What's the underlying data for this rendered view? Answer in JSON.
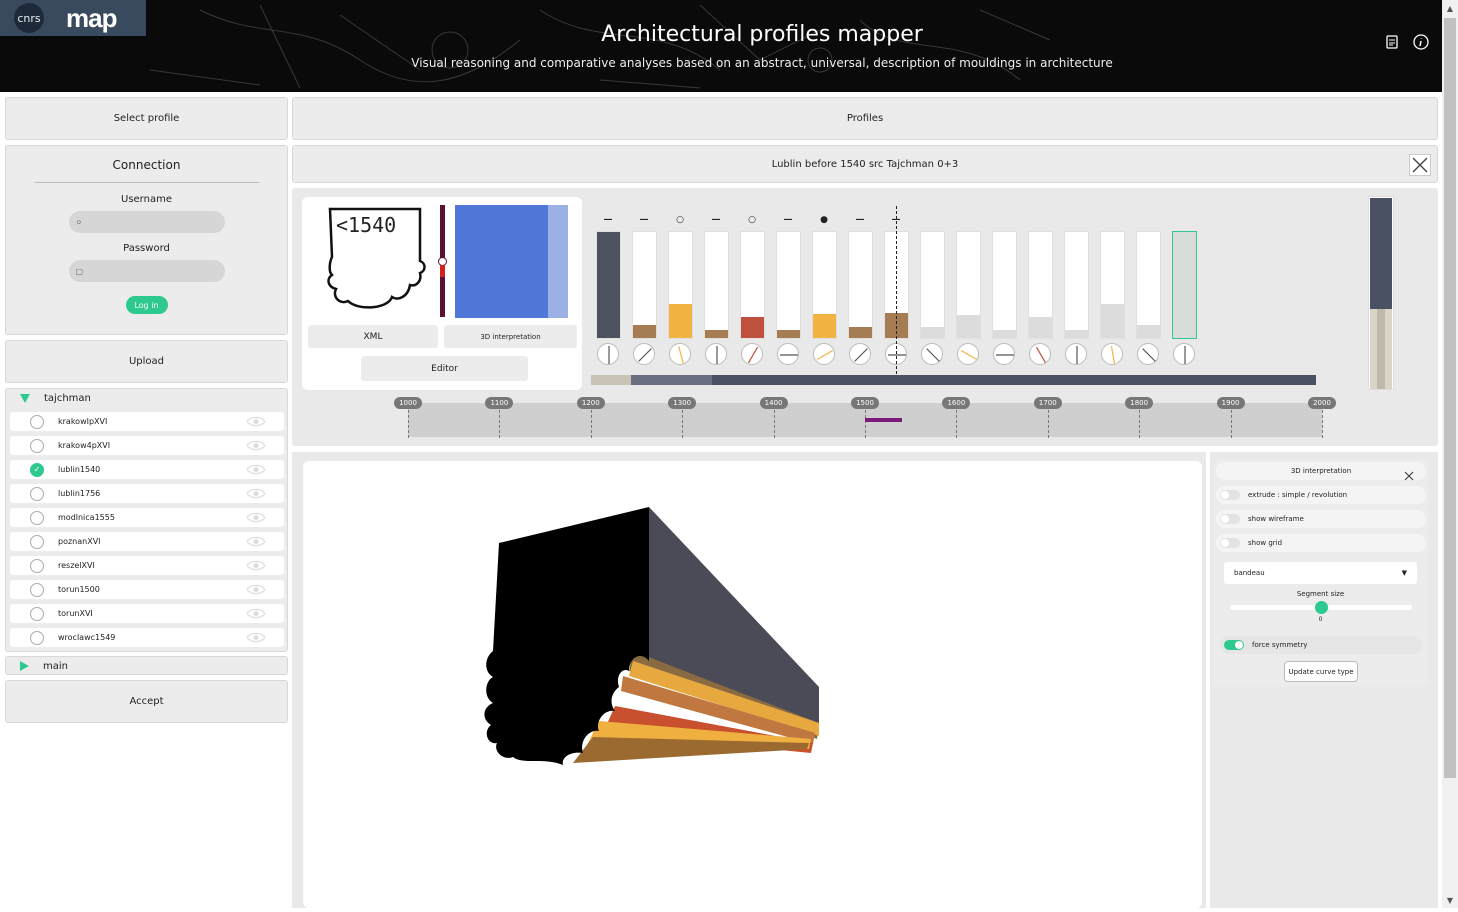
{
  "header": {
    "logo_org": "cnrs",
    "logo_app": "map",
    "title": "Architectural profiles mapper",
    "subtitle": "Visual reasoning and comparative analyses based on an abstract, universal, description of mouldings in architecture",
    "icons": [
      "document-icon",
      "info-icon"
    ]
  },
  "left": {
    "select_profile": "Select profile",
    "connection": {
      "title": "Connection",
      "username_label": "Username",
      "password_label": "Password",
      "login_label": "Log in"
    },
    "upload": "Upload",
    "groups": [
      {
        "name": "tajchman",
        "expanded": true,
        "items": [
          {
            "label": "krakowIpXVI",
            "checked": false
          },
          {
            "label": "krakow4pXVI",
            "checked": false
          },
          {
            "label": "lublin1540",
            "checked": true
          },
          {
            "label": "lublin1756",
            "checked": false
          },
          {
            "label": "modlnica1555",
            "checked": false
          },
          {
            "label": "poznanXVI",
            "checked": false
          },
          {
            "label": "reszelXVI",
            "checked": false
          },
          {
            "label": "torun1500",
            "checked": false
          },
          {
            "label": "torunXVI",
            "checked": false
          },
          {
            "label": "wroclawc1549",
            "checked": false
          }
        ]
      },
      {
        "name": "main",
        "expanded": false
      }
    ],
    "accept": "Accept"
  },
  "profiles": {
    "header": "Profiles",
    "current": "Lublin before 1540 src Tajchman 0+3",
    "profile_image_text": "<1540",
    "xml_label": "XML",
    "interp_label": "3D interpretation",
    "editor_label": "Editor",
    "bars": [
      {
        "level": 1.0,
        "color": "#4d5260",
        "symbol": "dash"
      },
      {
        "level": 0.12,
        "color": "#a67c52",
        "symbol": "dash"
      },
      {
        "level": 0.32,
        "color": "#f2b342",
        "symbol": "circle"
      },
      {
        "level": 0.08,
        "color": "#a67c52",
        "symbol": "dash"
      },
      {
        "level": 0.2,
        "color": "#c0503e",
        "symbol": "circle"
      },
      {
        "level": 0.08,
        "color": "#a67c52",
        "symbol": "dash"
      },
      {
        "level": 0.23,
        "color": "#f2b342",
        "symbol": "dot"
      },
      {
        "level": 0.1,
        "color": "#a67c52",
        "symbol": "dash"
      },
      {
        "level": 0.24,
        "color": "#a67c52",
        "symbol": "dash"
      },
      {
        "level": 0.1,
        "color": "#dcdcdc",
        "symbol": ""
      },
      {
        "level": 0.22,
        "color": "#dcdcdc",
        "symbol": ""
      },
      {
        "level": 0.08,
        "color": "#dcdcdc",
        "symbol": ""
      },
      {
        "level": 0.2,
        "color": "#dcdcdc",
        "symbol": ""
      },
      {
        "level": 0.08,
        "color": "#dcdcdc",
        "symbol": ""
      },
      {
        "level": 0.32,
        "color": "#dcdcdc",
        "symbol": ""
      },
      {
        "level": 0.12,
        "color": "#dcdcdc",
        "symbol": ""
      },
      {
        "level": 1.0,
        "color": "#d9dcd9",
        "symbol": ""
      }
    ],
    "dial_angles": [
      0,
      135,
      15,
      0,
      150,
      90,
      120,
      135,
      90,
      45,
      60,
      90,
      30,
      0,
      10,
      45,
      0
    ],
    "timeline_ticks": [
      "1000",
      "1100",
      "1200",
      "1300",
      "1400",
      "1500",
      "1600",
      "1700",
      "1800",
      "1900",
      "2000"
    ],
    "timeline_range": [
      1000,
      2000
    ],
    "highlight_range": [
      1500,
      1540
    ],
    "highlight_color": "#7a1a7a"
  },
  "interp_panel": {
    "title": "3D interpretation",
    "toggles": [
      {
        "label": "extrude : simple / revolution",
        "on": false
      },
      {
        "label": "show wireframe",
        "on": false
      },
      {
        "label": "show grid",
        "on": false
      }
    ],
    "select_value": "bandeau",
    "segment_label": "Segment size",
    "segment_value": "0",
    "force_symmetry_label": "force symmetry",
    "force_symmetry_on": true,
    "update_label": "Update curve type"
  },
  "colors": {
    "accent": "#2ec98f",
    "slate": "#4d5260",
    "panel": "#ececec"
  }
}
